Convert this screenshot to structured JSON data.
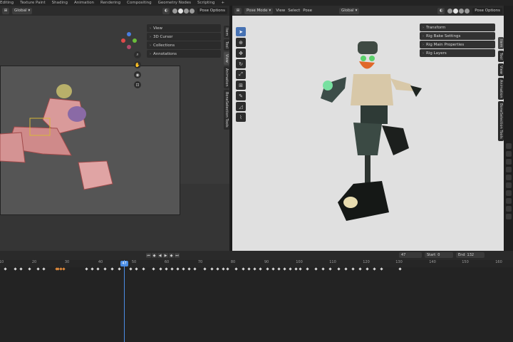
{
  "topbar": {
    "tabs": [
      "Editing",
      "Texture Paint",
      "Shading",
      "Animation",
      "Rendering",
      "Compositing",
      "Geometry Nodes",
      "Scripting",
      "+"
    ]
  },
  "left_view": {
    "header": {
      "orientation": "Global",
      "options": "Pose Options"
    },
    "npanel": [
      {
        "label": "View"
      },
      {
        "label": "3D Cursor"
      },
      {
        "label": "Collections"
      },
      {
        "label": "Annotations"
      }
    ],
    "tabs": [
      "Item",
      "Tool",
      "View",
      "Animation",
      "BoneSelection Tools"
    ]
  },
  "right_view": {
    "header": {
      "mode": "Pose Mode",
      "menus": [
        "View",
        "Select",
        "Pose"
      ],
      "orientation": "Global",
      "options": "Pose Options"
    },
    "panels": [
      {
        "label": "Transform"
      },
      {
        "label": "Rig Bake Settings"
      },
      {
        "label": "Rig Main Properties"
      },
      {
        "label": "Rig Layers"
      }
    ],
    "tabs": [
      "Item",
      "Tool",
      "View",
      "Animation",
      "BoneSelection Tools"
    ]
  },
  "timeline": {
    "current_frame": "47",
    "start_label": "Start",
    "start_value": "0",
    "end_label": "End",
    "end_value": "132",
    "frame_badge": "47",
    "ticks": [
      "10",
      "20",
      "30",
      "40",
      "50",
      "60",
      "70",
      "80",
      "90",
      "100",
      "110",
      "120",
      "130",
      "140",
      "150",
      "160"
    ]
  },
  "colors": {
    "accent": "#4b8ee6",
    "selected_keyframe": "#e08a3b",
    "viewport_bg": "#e0e0e0"
  }
}
